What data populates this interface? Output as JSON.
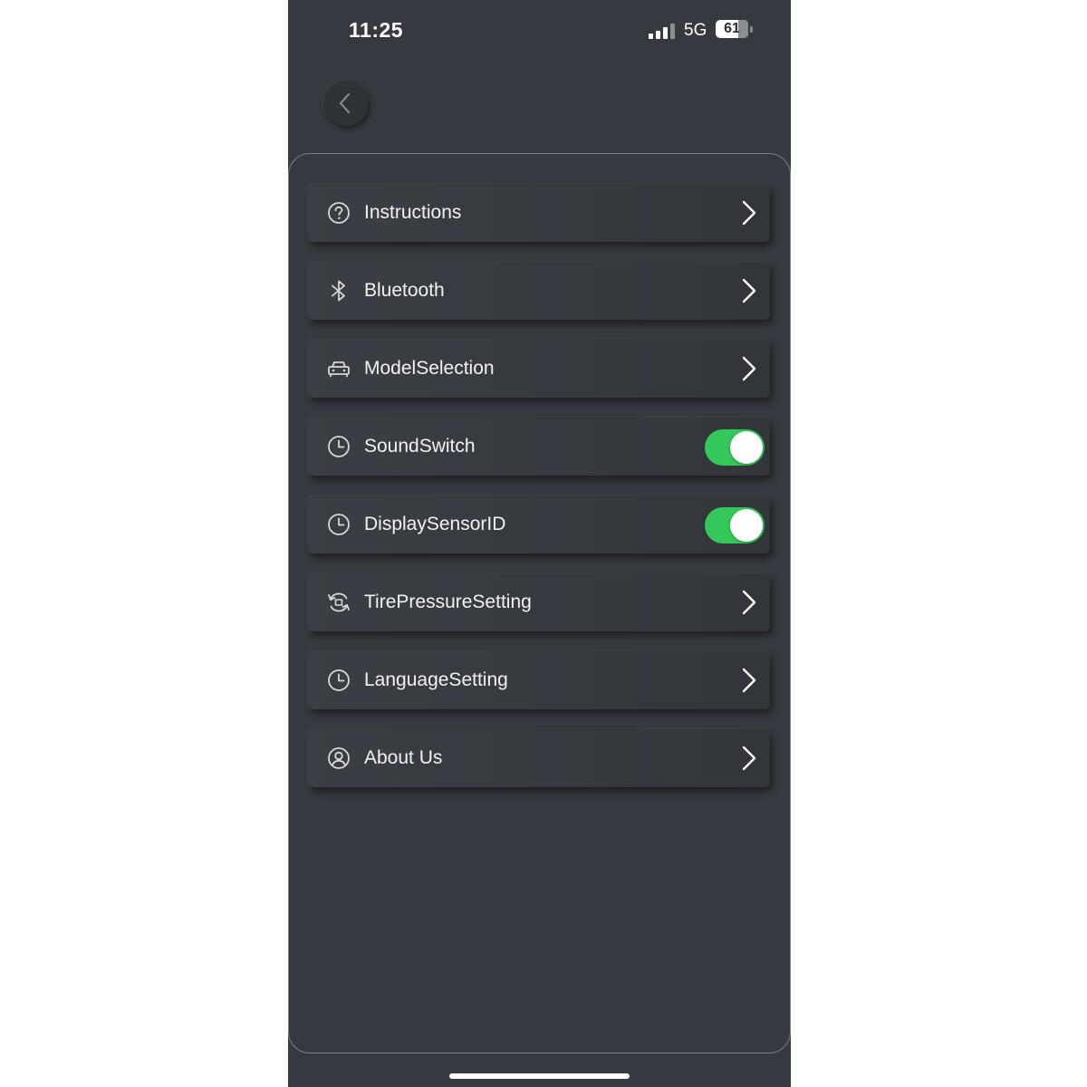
{
  "status_bar": {
    "time": "11:25",
    "network": "5G",
    "battery_level": "61"
  },
  "nav": {
    "back_icon": "chevron-left-icon"
  },
  "menu": {
    "items": [
      {
        "label": "Instructions",
        "icon": "help-circle-icon",
        "control": "chevron"
      },
      {
        "label": "Bluetooth",
        "icon": "bluetooth-icon",
        "control": "chevron"
      },
      {
        "label": "ModelSelection",
        "icon": "car-icon",
        "control": "chevron"
      },
      {
        "label": "SoundSwitch",
        "icon": "clock-icon",
        "control": "toggle",
        "toggle_on": true
      },
      {
        "label": "DisplaySensorID",
        "icon": "clock-icon",
        "control": "toggle",
        "toggle_on": true
      },
      {
        "label": "TirePressureSetting",
        "icon": "sync-icon",
        "control": "chevron"
      },
      {
        "label": "LanguageSetting",
        "icon": "clock-icon",
        "control": "chevron"
      },
      {
        "label": "About Us",
        "icon": "user-circle-icon",
        "control": "chevron"
      }
    ]
  },
  "colors": {
    "background": "#363a40",
    "toggle_on": "#34c759",
    "text": "#f1f2f3"
  }
}
